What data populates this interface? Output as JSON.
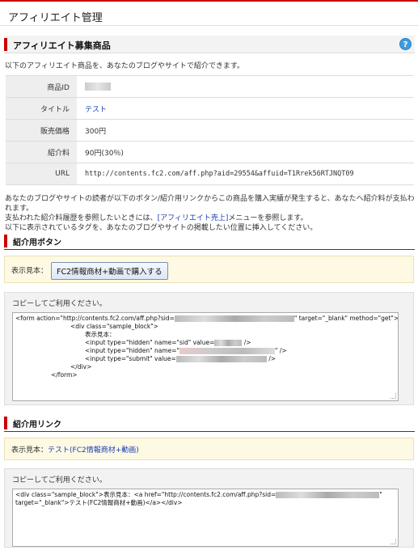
{
  "header": {
    "title": "アフィリエイト管理"
  },
  "section1": {
    "title": "アフィリエイト募集商品",
    "help_icon": "question-mark-icon"
  },
  "intro": "以下のアフィリエイト商品を、あなたのブログやサイトで紹介できます。",
  "product": {
    "rows": [
      {
        "key": "商品ID",
        "value": ""
      },
      {
        "key": "タイトル",
        "value": "テスト"
      },
      {
        "key": "販売価格",
        "value": "300円"
      },
      {
        "key": "紹介料",
        "value": "90円(30％)"
      },
      {
        "key": "URL",
        "value": "http://contents.fc2.com/aff.php?aid=29554&affuid=T1Rrek56RTJNQT09"
      }
    ]
  },
  "description": {
    "line1": "あなたのブログやサイトの読者が以下のボタン/紹介用リンクからこの商品を購入実績が発生すると、あなたへ紹介料が支払われます。",
    "line2_pre": "支払われた紹介料履歴を参照したいときには、",
    "line2_link": "[アフィリエイト売上]",
    "line2_post": "メニューを参照します。",
    "line3": "以下に表示されているタグを、あなたのブログやサイトの掲載したい位置に挿入してください。"
  },
  "button_section": {
    "title": "紹介用ボタン",
    "sample_label": "表示見本：",
    "button_label": "FC2情報商材+動画で購入する",
    "copy_label": "コピーしてご利用ください。",
    "code": {
      "l1a": "<form action=\"http://contents.fc2.com/aff.php?sid=",
      "l1b": "\" target=\"_blank\" method=\"get\">",
      "l2": "<div class=\"sample_block\">",
      "l3": "表示見本：",
      "l4a": "<input type=\"hidden\" name=\"sid\" value=",
      "l4b": " />",
      "l5a": "<input type=\"hidden\" name=\"",
      "l5b": "\" />",
      "l6a": "<input type=\"submit\" value=",
      "l6b": " />",
      "l7": "</div>",
      "l8": "</form>"
    }
  },
  "link_section": {
    "title": "紹介用リンク",
    "sample_label": "表示見本：",
    "sample_link": "テスト(FC2情報商材+動画)",
    "copy_label": "コピーしてご利用ください。",
    "code": {
      "l1a": "<div class=\"sample_block\">表示見本：<a href=\"http://contents.fc2.com/aff.php?sid=",
      "l1b": "\"",
      "l2": "target=\"_blank\">テスト(FC2情報商材+動画)</a></div>"
    }
  }
}
